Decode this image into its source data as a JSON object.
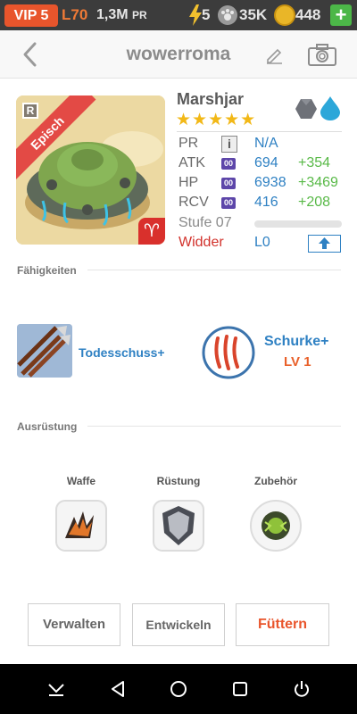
{
  "status_bar": {
    "vip": "VIP 5",
    "level": "L70",
    "power": "1,3M",
    "power_unit": "PR",
    "energy": "5",
    "food": "35K",
    "coins": "448",
    "add_label": "+"
  },
  "header": {
    "title": "wowerroma"
  },
  "monster": {
    "rarity_letter": "R",
    "rarity_ribbon": "Episch",
    "name": "Marshjar",
    "stars": "★★★★★",
    "stats": [
      {
        "label": "PR",
        "value": "N/A",
        "bonus": ""
      },
      {
        "label": "ATK",
        "box": "00",
        "value": "694",
        "bonus": "+354"
      },
      {
        "label": "HP",
        "box": "00",
        "value": "6938",
        "bonus": "+3469"
      },
      {
        "label": "RCV",
        "box": "00",
        "value": "416",
        "bonus": "+208"
      }
    ],
    "info_label": "i",
    "level_label": "Stufe 07",
    "level_progress": 0,
    "sign_label": "Widder",
    "sign_value": "L0"
  },
  "skills": {
    "title": "Fähigkeiten",
    "skill1_name": "Todesschuss+",
    "skill2_name": "Schurke+",
    "skill2_level": "LV 1"
  },
  "equipment": {
    "title": "Ausrüstung",
    "weapon": "Waffe",
    "armor": "Rüstung",
    "accessory": "Zubehör"
  },
  "actions": {
    "manage": "Verwalten",
    "evolve": "Entwickeln",
    "feed": "Füttern"
  },
  "colors": {
    "accent_orange": "#e9552c",
    "link_blue": "#2f81c3",
    "bonus_green": "#58b947",
    "star_gold": "#f2b817"
  }
}
